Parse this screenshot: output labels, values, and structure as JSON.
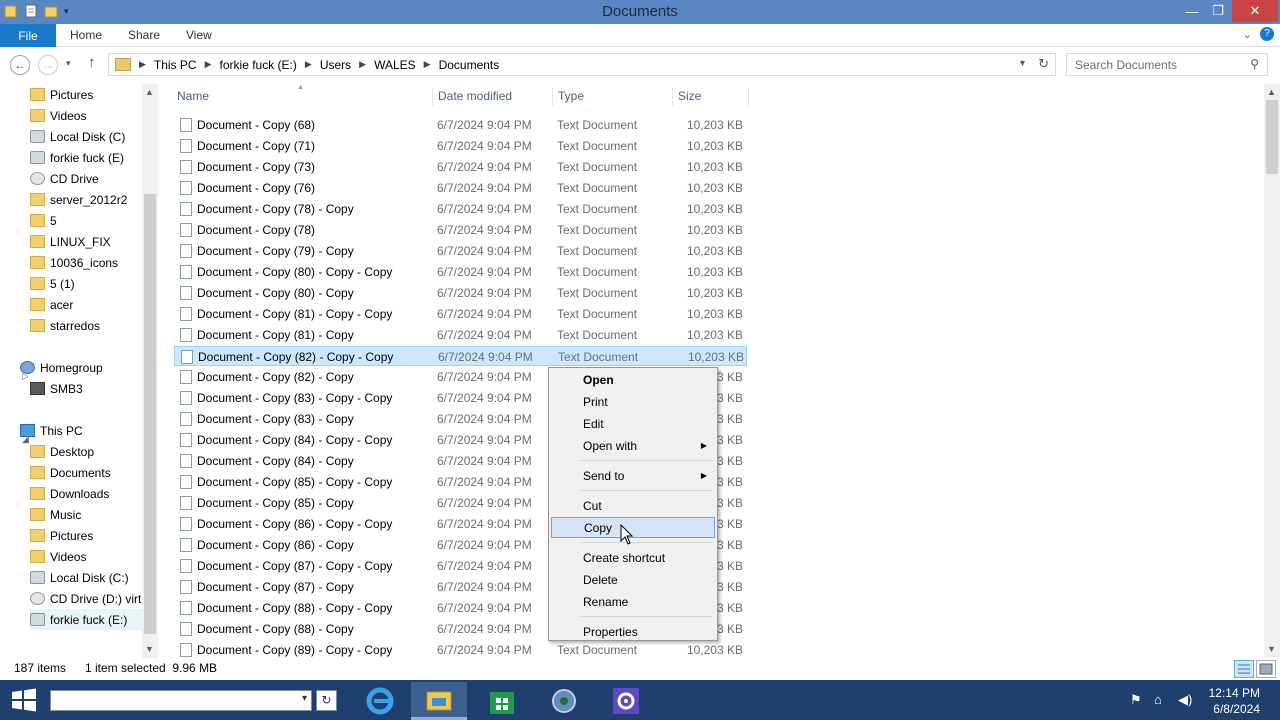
{
  "window": {
    "title": "Documents"
  },
  "ribbon": {
    "file": "File",
    "tabs": [
      "Home",
      "Share",
      "View"
    ]
  },
  "address": {
    "crumbs": [
      "This PC",
      "forkie fuck (E:)",
      "Users",
      "WALES",
      "Documents"
    ]
  },
  "search": {
    "placeholder": "Search Documents"
  },
  "nav": {
    "items": [
      {
        "label": "Pictures",
        "icon": "folder"
      },
      {
        "label": "Videos",
        "icon": "folder"
      },
      {
        "label": "Local Disk (C)",
        "icon": "drive"
      },
      {
        "label": "forkie fuck (E)",
        "icon": "drive"
      },
      {
        "label": "CD Drive",
        "icon": "disc"
      },
      {
        "label": "server_2012r2",
        "icon": "folder"
      },
      {
        "label": "5",
        "icon": "folder"
      },
      {
        "label": "LINUX_FIX",
        "icon": "folder"
      },
      {
        "label": "10036_icons",
        "icon": "folder"
      },
      {
        "label": "5 (1)",
        "icon": "folder"
      },
      {
        "label": "acer",
        "icon": "folder"
      },
      {
        "label": "starredos",
        "icon": "folder"
      },
      {
        "label": "Homegroup",
        "icon": "net"
      },
      {
        "label": "SMB3",
        "icon": "comp"
      },
      {
        "label": "This PC",
        "icon": "pc"
      },
      {
        "label": "Desktop",
        "icon": "folder"
      },
      {
        "label": "Documents",
        "icon": "folder"
      },
      {
        "label": "Downloads",
        "icon": "folder"
      },
      {
        "label": "Music",
        "icon": "folder"
      },
      {
        "label": "Pictures",
        "icon": "folder"
      },
      {
        "label": "Videos",
        "icon": "folder"
      },
      {
        "label": "Local Disk (C:)",
        "icon": "drive"
      },
      {
        "label": "CD Drive (D:) virt",
        "icon": "disc"
      },
      {
        "label": "forkie fuck (E:)",
        "icon": "drive"
      }
    ]
  },
  "columns": {
    "name": "Name",
    "date": "Date modified",
    "type": "Type",
    "size": "Size"
  },
  "files": [
    {
      "name": "Document - Copy (68)",
      "date": "6/7/2024 9:04 PM",
      "type": "Text Document",
      "size": "10,203 KB"
    },
    {
      "name": "Document - Copy (71)",
      "date": "6/7/2024 9:04 PM",
      "type": "Text Document",
      "size": "10,203 KB"
    },
    {
      "name": "Document - Copy (73)",
      "date": "6/7/2024 9:04 PM",
      "type": "Text Document",
      "size": "10,203 KB"
    },
    {
      "name": "Document - Copy (76)",
      "date": "6/7/2024 9:04 PM",
      "type": "Text Document",
      "size": "10,203 KB"
    },
    {
      "name": "Document - Copy (78) - Copy",
      "date": "6/7/2024 9:04 PM",
      "type": "Text Document",
      "size": "10,203 KB"
    },
    {
      "name": "Document - Copy (78)",
      "date": "6/7/2024 9:04 PM",
      "type": "Text Document",
      "size": "10,203 KB"
    },
    {
      "name": "Document - Copy (79) - Copy",
      "date": "6/7/2024 9:04 PM",
      "type": "Text Document",
      "size": "10,203 KB"
    },
    {
      "name": "Document - Copy (80) - Copy - Copy",
      "date": "6/7/2024 9:04 PM",
      "type": "Text Document",
      "size": "10,203 KB"
    },
    {
      "name": "Document - Copy (80) - Copy",
      "date": "6/7/2024 9:04 PM",
      "type": "Text Document",
      "size": "10,203 KB"
    },
    {
      "name": "Document - Copy (81) - Copy - Copy",
      "date": "6/7/2024 9:04 PM",
      "type": "Text Document",
      "size": "10,203 KB"
    },
    {
      "name": "Document - Copy (81) - Copy",
      "date": "6/7/2024 9:04 PM",
      "type": "Text Document",
      "size": "10,203 KB"
    },
    {
      "name": "Document - Copy (82) - Copy - Copy",
      "date": "6/7/2024 9:04 PM",
      "type": "Text Document",
      "size": "10,203 KB",
      "selected": true
    },
    {
      "name": "Document - Copy (82) - Copy",
      "date": "6/7/2024 9:04 PM",
      "type": "",
      "size": "203 KB"
    },
    {
      "name": "Document - Copy (83) - Copy - Copy",
      "date": "6/7/2024 9:04 PM",
      "type": "",
      "size": "203 KB"
    },
    {
      "name": "Document - Copy (83) - Copy",
      "date": "6/7/2024 9:04 PM",
      "type": "",
      "size": "203 KB"
    },
    {
      "name": "Document - Copy (84) - Copy - Copy",
      "date": "6/7/2024 9:04 PM",
      "type": "",
      "size": "203 KB"
    },
    {
      "name": "Document - Copy (84) - Copy",
      "date": "6/7/2024 9:04 PM",
      "type": "",
      "size": "203 KB"
    },
    {
      "name": "Document - Copy (85) - Copy - Copy",
      "date": "6/7/2024 9:04 PM",
      "type": "",
      "size": "203 KB"
    },
    {
      "name": "Document - Copy (85) - Copy",
      "date": "6/7/2024 9:04 PM",
      "type": "",
      "size": "203 KB"
    },
    {
      "name": "Document - Copy (86) - Copy - Copy",
      "date": "6/7/2024 9:04 PM",
      "type": "",
      "size": "203 KB"
    },
    {
      "name": "Document - Copy (86) - Copy",
      "date": "6/7/2024 9:04 PM",
      "type": "",
      "size": "203 KB"
    },
    {
      "name": "Document - Copy (87) - Copy - Copy",
      "date": "6/7/2024 9:04 PM",
      "type": "",
      "size": "203 KB"
    },
    {
      "name": "Document - Copy (87) - Copy",
      "date": "6/7/2024 9:04 PM",
      "type": "",
      "size": "203 KB"
    },
    {
      "name": "Document - Copy (88) - Copy - Copy",
      "date": "6/7/2024 9:04 PM",
      "type": "",
      "size": "203 KB"
    },
    {
      "name": "Document - Copy (88) - Copy",
      "date": "6/7/2024 9:04 PM",
      "type": "",
      "size": "203 KB"
    },
    {
      "name": "Document - Copy (89) - Copy - Copy",
      "date": "6/7/2024 9:04 PM",
      "type": "Text Document",
      "size": "10,203 KB"
    }
  ],
  "context_menu": [
    {
      "label": "Open",
      "bold": true
    },
    {
      "label": "Print"
    },
    {
      "label": "Edit"
    },
    {
      "label": "Open with",
      "submenu": true
    },
    {
      "sep": true
    },
    {
      "label": "Send to",
      "submenu": true
    },
    {
      "sep": true
    },
    {
      "label": "Cut"
    },
    {
      "label": "Copy",
      "highlighted": true
    },
    {
      "sep": true
    },
    {
      "label": "Create shortcut"
    },
    {
      "label": "Delete"
    },
    {
      "label": "Rename"
    },
    {
      "sep": true
    },
    {
      "label": "Properties"
    }
  ],
  "status": {
    "items": "187 items",
    "selected": "1 item selected  9.96 MB"
  },
  "taskbar": {
    "time": "12:14 PM",
    "date": "6/8/2024"
  },
  "colors": {
    "titlebar": "#5b86c4",
    "file_tab": "#1979ca",
    "close": "#c84343",
    "selection": "#cce8ff",
    "taskbar": "#1f3f6e"
  }
}
